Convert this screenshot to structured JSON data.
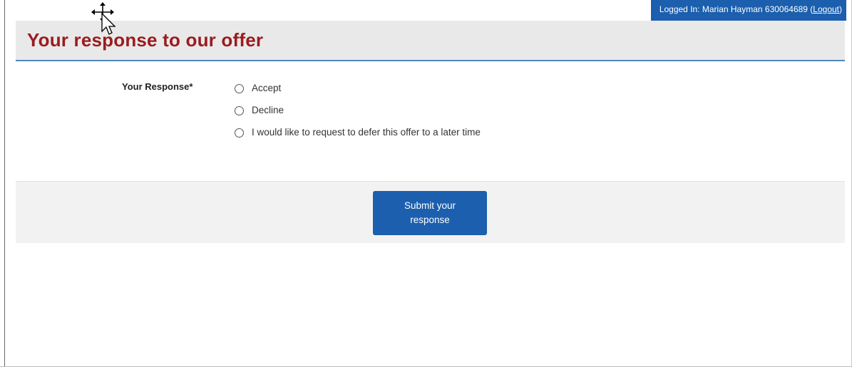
{
  "session": {
    "logged_in_prefix": "Logged In: Marian Hayman 630064689 (",
    "logout_link": "Logout",
    "logged_in_suffix": ")"
  },
  "header": {
    "title": "Your response to our offer"
  },
  "form": {
    "response_label": "Your Response*",
    "options": [
      {
        "label": "Accept"
      },
      {
        "label": "Decline"
      },
      {
        "label": "I would like to request to defer this offer to a later time"
      }
    ]
  },
  "actions": {
    "submit_label": "Submit your response"
  },
  "colors": {
    "brand_blue": "#1b5fae",
    "title_red": "#9a1c1f",
    "header_bg": "#e9e9e9",
    "header_rule": "#4f86c4",
    "action_bar_bg": "#f2f2f2"
  },
  "icons": {
    "cursor": "move-cursor-icon"
  }
}
